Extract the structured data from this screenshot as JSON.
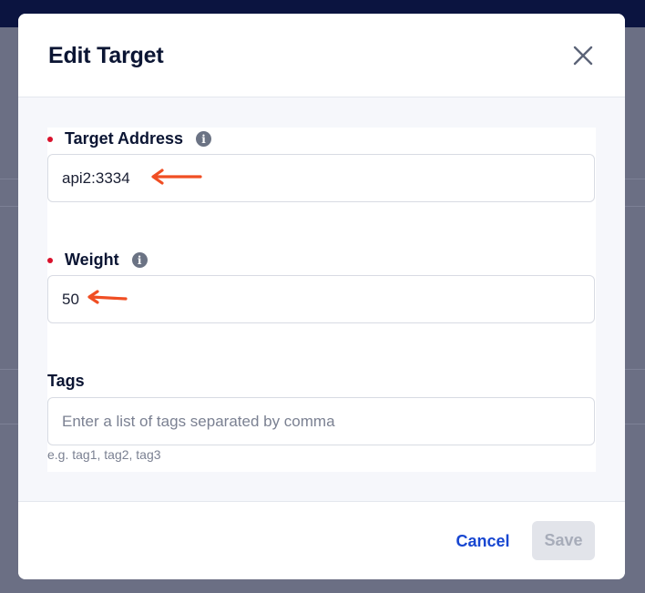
{
  "dialog": {
    "title": "Edit Target",
    "close_icon": "close-icon"
  },
  "fields": {
    "target_address": {
      "label": "Target Address",
      "required": true,
      "info_icon": "info-icon",
      "value": "api2:3334"
    },
    "weight": {
      "label": "Weight",
      "required": true,
      "info_icon": "info-icon",
      "value": "50"
    },
    "tags": {
      "label": "Tags",
      "required": false,
      "value": "",
      "placeholder": "Enter a list of tags separated by comma",
      "hint": "e.g. tag1, tag2, tag3"
    }
  },
  "footer": {
    "cancel_label": "Cancel",
    "save_label": "Save"
  },
  "colors": {
    "accent": "#1746d1",
    "required": "#d9112c",
    "annotation_arrow": "#f04e23"
  }
}
